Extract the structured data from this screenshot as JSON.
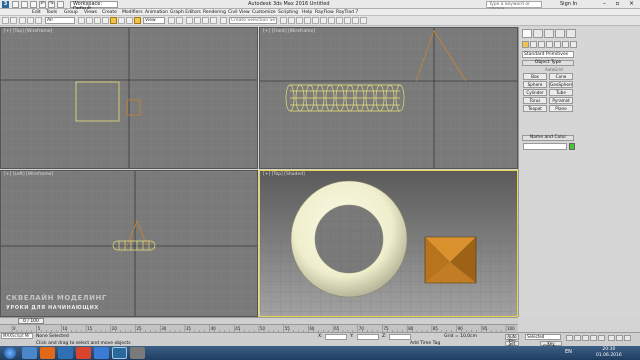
{
  "titlebar": {
    "workspace": "Workspace: Default",
    "title": "Autodesk 3ds Max 2016    Untitled",
    "search_placeholder": "Type a keyword or phrase",
    "sign_in": "Sign In"
  },
  "menu": [
    "Edit",
    "Tools",
    "Group",
    "Views",
    "Create",
    "Modifiers",
    "Animation",
    "Graph Editors",
    "Rendering",
    "Civil View",
    "Customize",
    "Scripting",
    "Help",
    "RayFlow",
    "RayTrad 7"
  ],
  "toolbar": {
    "filter_value": "All",
    "refcoord_value": "View",
    "named_selection_placeholder": "Create Selection Se"
  },
  "viewports": {
    "top_label": "[+] [Top] [Wireframe]",
    "front_label": "[+] [Front] [Wireframe]",
    "left_label": "[+] [Left] [Wireframe]",
    "persp_label": "[+] [Top] [Shaded]"
  },
  "watermark": {
    "line1": "СКВЕЛАЙН     МОДЕЛИНГ",
    "line2": "УРОКИ ДЛЯ НАЧИНАЮЩИХ"
  },
  "command_panel": {
    "dropdown": "Standard Primitives",
    "object_type_title": "Object Type",
    "autogrid_label": "AutoGrid",
    "objects": [
      "Box",
      "Cone",
      "Sphere",
      "GeoSphere",
      "Cylinder",
      "Tube",
      "Torus",
      "Pyramid",
      "Teapot",
      "Plane"
    ],
    "name_color_title": "Name and Color",
    "swatch_color": "#47c23a"
  },
  "timeline": {
    "frame": "0 / 100",
    "ticks": [
      "0",
      "5",
      "10",
      "15",
      "20",
      "25",
      "30",
      "35",
      "40",
      "45",
      "50",
      "55",
      "60",
      "65",
      "70",
      "75",
      "80",
      "85",
      "90",
      "95",
      "100"
    ]
  },
  "status": {
    "maxscript": "MAXScript Mi",
    "selection": "None Selected",
    "prompt": "Click and drag to select and move objects",
    "x_label": "X:",
    "y_label": "Y:",
    "z_label": "Z:",
    "grid": "Grid = 10,0cm",
    "add_time_tag": "Add Time Tag",
    "auto_key": "Auto Key",
    "set_key": "Set Key",
    "selected_value": "Selected",
    "key_filters": "Key Filters..."
  },
  "taskbar": {
    "language": "EN",
    "time": "20:30",
    "date": "01.06.2016"
  },
  "colors": {
    "accent_active_tool": "#f3c24a",
    "selection_outline": "#e6d64a",
    "wireframe_yellow": "#e8e17a",
    "pyramid": "#c9832e",
    "torus": "#efeecc"
  }
}
